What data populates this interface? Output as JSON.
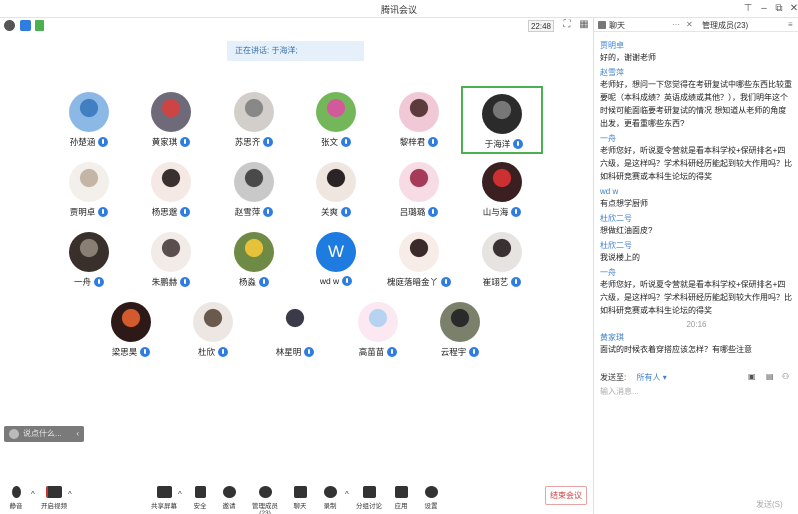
{
  "window": {
    "title": "腾讯会议"
  },
  "topbar": {
    "time": "22:48"
  },
  "stage": {
    "speaking": "正在讲话: 于海洋;",
    "say_placeholder": "说点什么..."
  },
  "participants": [
    {
      "name": "孙楚涵",
      "color": "#8cb8e6",
      "color2": "#3f7fc2"
    },
    {
      "name": "黄家琪",
      "color": "#6f6a7a",
      "color2": "#c44"
    },
    {
      "name": "苏思齐",
      "color": "#d2cfca",
      "color2": "#888"
    },
    {
      "name": "张文",
      "color": "#74b75a",
      "color2": "#d25a9a"
    },
    {
      "name": "黎梓君",
      "color": "#f1c9d6",
      "color2": "#5b3b3b"
    },
    {
      "name": "于海洋",
      "color": "#2b2b2b",
      "color2": "#777"
    },
    {
      "name": "贾明卓",
      "color": "#f3efea",
      "color2": "#c4b6a6"
    },
    {
      "name": "杨思邈",
      "color": "#f4e9e4",
      "color2": "#3a3030"
    },
    {
      "name": "赵雪萍",
      "color": "#c9c9c9",
      "color2": "#4a4a4a"
    },
    {
      "name": "关爽",
      "color": "#efe6e0",
      "color2": "#2a2424"
    },
    {
      "name": "吕璐璐",
      "color": "#f7dbe5",
      "color2": "#a63a59"
    },
    {
      "name": "山与海",
      "color": "#3a2020",
      "color2": "#cc3030"
    },
    {
      "name": "一舟",
      "color": "#39302b",
      "color2": "#8a7f74"
    },
    {
      "name": "朱鹏赫",
      "color": "#f2ebe8",
      "color2": "#5a4e4e"
    },
    {
      "name": "杨淼",
      "color": "#6e8a44",
      "color2": "#e6c23a"
    },
    {
      "name": "wd w",
      "color": "#1e7be0",
      "color2": "#1e7be0"
    },
    {
      "name": "槐庭落暗金丫",
      "color": "#f7ece8",
      "color2": "#3a2a2a"
    },
    {
      "name": "崔翊艺",
      "color": "#e6e3e0",
      "color2": "#3a3232"
    },
    {
      "name": "梁思昊",
      "color": "#2d1a18",
      "color2": "#d25a2d"
    },
    {
      "name": "杜欣",
      "color": "#ece7e2",
      "color2": "#6a5a4e"
    },
    {
      "name": "林星明",
      "color": "#ffffff",
      "color2": "#3a3a4a"
    },
    {
      "name": "高苗苗",
      "color": "#fbe8f1",
      "color2": "#b6d4f2"
    },
    {
      "name": "云程宇",
      "color": "#7a806a",
      "color2": "#2a2a2a"
    }
  ],
  "avatar_w_letter": "W",
  "toolbar": {
    "mute": "静音",
    "video": "开启视频",
    "share": "共享屏幕",
    "security": "安全",
    "invite": "邀请",
    "manage": "管理成员(23)",
    "chat": "聊天",
    "record": "录制",
    "breakout": "分组讨论",
    "apps": "应用",
    "settings": "设置",
    "end": "结束会议"
  },
  "panel": {
    "tab_chat": "聊天",
    "tab_members": "管理成员(23)",
    "messages": [
      {
        "sender": "贾明卓",
        "text": "好的，谢谢老师"
      },
      {
        "sender": "赵雪萍",
        "text": "老师好，想问一下您觉得在考研复试中哪些东西比较重要呢（本科成绩？英语成绩或其他？），我们明年这个时候可能面临要考研复试的情况 想知道从老师的角度出发，更看重哪些东西?"
      },
      {
        "sender": "一舟",
        "text": "老师您好，听说夏令营就是看本科学校+保研排名+四六级，是这样吗？学术科研经历能起到较大作用吗？比如科研竞赛或本科生论坛的得奖"
      },
      {
        "sender": "wd w",
        "text": "有点想学厨师"
      },
      {
        "sender": "杜欣二号",
        "text": "想做红油面皮?"
      },
      {
        "sender": "杜欣二号",
        "text": "我说楼上的"
      },
      {
        "sender": "一舟",
        "text": "老师您好，听说夏令营就是看本科学校+保研排名+四六级，是这样吗？学术科研经历能起到较大作用吗？比如科研竞赛或本科生论坛的得奖"
      }
    ],
    "time_sep": "20:16",
    "last_msg": {
      "sender": "黄家琪",
      "text": "面试的时候衣着穿搭应该怎样？有哪些注意"
    },
    "send_to_label": "发送至:",
    "send_to_value": "所有人 ▾",
    "input_placeholder": "输入消息...",
    "send_label": "发送(S)"
  }
}
